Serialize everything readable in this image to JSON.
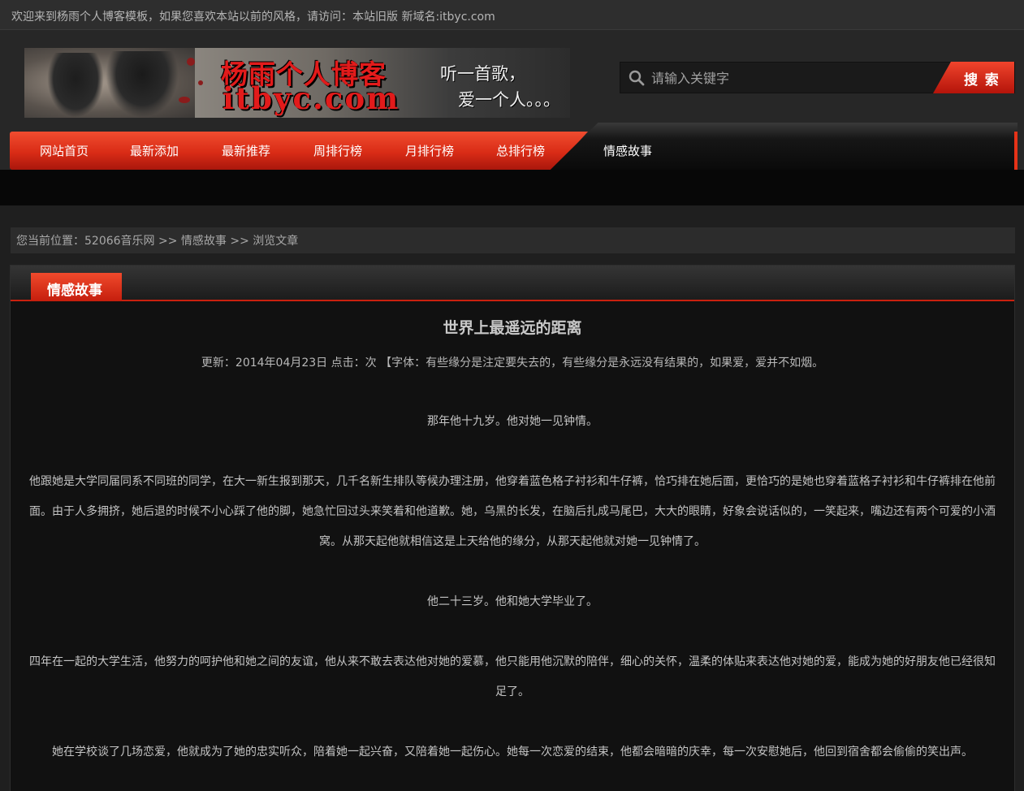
{
  "topbar": {
    "welcome": "欢迎来到杨雨个人博客模板，如果您喜欢本站以前的风格，请访问：本站旧版 新域名:itbyc.com"
  },
  "logo": {
    "title_cn": "杨雨个人博客",
    "domain": "itbyc.com",
    "slogan_line1": "听一首歌，",
    "slogan_line2": "爱一个人。。。"
  },
  "search": {
    "placeholder": "请输入关键字",
    "button_label": "搜 索"
  },
  "nav": {
    "items": [
      {
        "label": "网站首页"
      },
      {
        "label": "最新添加"
      },
      {
        "label": "最新推荐"
      },
      {
        "label": "周排行榜"
      },
      {
        "label": "月排行榜"
      },
      {
        "label": "总排行榜"
      },
      {
        "label": "情感故事",
        "active": true
      }
    ]
  },
  "breadcrumb": {
    "text": "您当前位置：52066音乐网 >> 情感故事 >> 浏览文章"
  },
  "panel": {
    "tab_label": "情感故事"
  },
  "article": {
    "title": "世界上最遥远的距离",
    "meta": "更新：2014年04月23日 点击：次 【字体：有些缘分是注定要失去的，有些缘分是永远没有结果的，如果爱，爱并不如烟。",
    "paragraphs": [
      "那年他十九岁。他对她一见钟情。",
      "他跟她是大学同届同系不同班的同学，在大一新生报到那天，几千名新生排队等候办理注册，他穿着蓝色格子衬衫和牛仔裤，恰巧排在她后面，更恰巧的是她也穿着蓝格子衬衫和牛仔裤排在他前面。由于人多拥挤，她后退的时候不小心踩了他的脚，她急忙回过头来笑着和他道歉。她，乌黑的长发，在脑后扎成马尾巴，大大的眼睛，好象会说话似的，一笑起来，嘴边还有两个可爱的小酒窝。从那天起他就相信这是上天给他的缘分，从那天起他就对她一见钟情了。",
      "他二十三岁。他和她大学毕业了。",
      "四年在一起的大学生活，他努力的呵护他和她之间的友谊，他从来不敢去表达他对她的爱慕，他只能用他沉默的陪伴，细心的关怀，温柔的体贴来表达他对她的爱，能成为她的好朋友他已经很知足了。",
      "她在学校谈了几场恋爱，他就成为了她的忠实听众，陪着她一起兴奋，又陪着她一起伤心。她每一次恋爱的结束，他都会暗暗的庆幸，每一次安慰她后，他回到宿舍都会偷偷的笑出声。"
    ]
  },
  "colors": {
    "accent_red": "#e2301a",
    "background": "#1f1f1f",
    "panel": "#111111"
  }
}
